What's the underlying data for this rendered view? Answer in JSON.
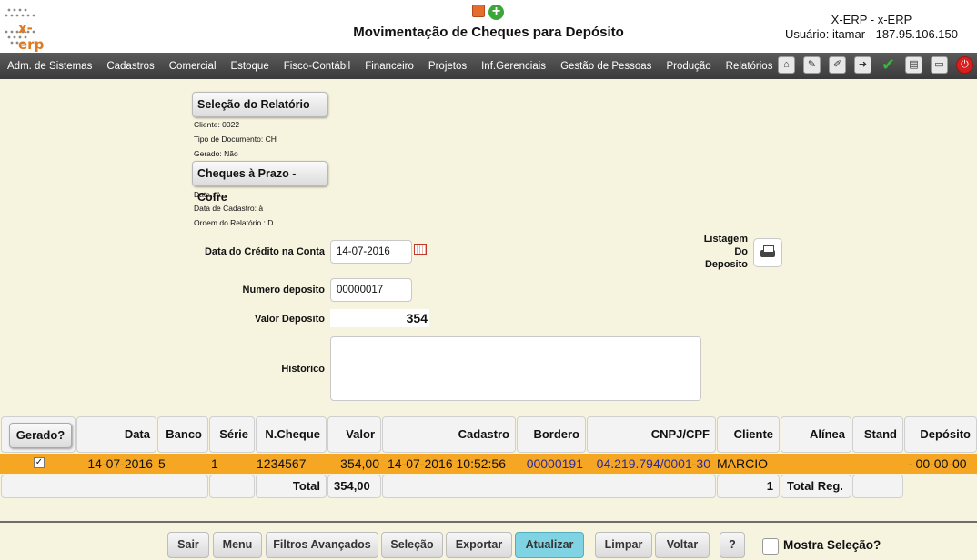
{
  "header": {
    "logo_text": "x-erp",
    "title": "Movimentação de Cheques para Depósito",
    "user_line1": "X-ERP - x-ERP",
    "user_line2": "Usuário: itamar - 187.95.106.150"
  },
  "menu": {
    "items": [
      "Adm. de Sistemas",
      "Cadastros",
      "Comercial",
      "Estoque",
      "Fisco-Contábil",
      "Financeiro",
      "Projetos",
      "Inf.Gerenciais",
      "Gestão de Pessoas",
      "Produção",
      "Relatórios"
    ],
    "icons": [
      "home-icon",
      "edit-icon",
      "edit-doc-icon",
      "export-icon",
      "check-icon",
      "document-icon",
      "print-icon",
      "power-icon"
    ]
  },
  "selecao": {
    "button": "Seleção do Relatório",
    "cliente": "Cliente: 0022",
    "tipo": "Tipo de Documento: CH",
    "gerado": "Gerado: Não"
  },
  "cheques": {
    "button": "Cheques à Prazo - Cofre",
    "data": "Data :  à",
    "data_cadastro": "Data de Cadastro:  à",
    "ordem": "Ordem do Relatório : D"
  },
  "form": {
    "data_credito_label": "Data do Crédito na Conta",
    "data_credito_value": "14-07-2016",
    "numero_label": "Numero deposito",
    "numero_value": "00000017",
    "valor_label": "Valor Deposito",
    "valor_value": "354",
    "historico_label": "Historico",
    "listagem_line1": "Listagem",
    "listagem_line2": "Do",
    "listagem_line3": "Deposito"
  },
  "table": {
    "headers": {
      "gerado": "Gerado?",
      "data": "Data",
      "banco": "Banco",
      "serie": "Série",
      "ncheque": "N.Cheque",
      "valor": "Valor",
      "cadastro": "Cadastro",
      "bordero": "Bordero",
      "cnpj": "CNPJ/CPF",
      "cliente": "Cliente",
      "alinea": "Alínea",
      "stand": "Stand",
      "deposito": "Depósito"
    },
    "row": {
      "checked": "✓",
      "data": "14-07-2016",
      "banco": "5",
      "serie": "1",
      "ncheque": "1234567",
      "valor": "354,00",
      "cadastro": "14-07-2016 10:52:56",
      "bordero": "00000191",
      "cnpj": "04.219.794/0001-30",
      "cliente": "MARCIO",
      "alinea": "",
      "stand": "",
      "deposito": "- 00-00-00"
    },
    "totals": {
      "label": "Total",
      "valor": "354,00",
      "count": "1",
      "reg_label": "Total Reg."
    }
  },
  "buttons": {
    "sair": "Sair",
    "menu": "Menu",
    "filtros": "Filtros Avançados",
    "selecao": "Seleção",
    "exportar": "Exportar",
    "atualizar": "Atualizar",
    "limpar": "Limpar",
    "voltar": "Voltar",
    "help": "?",
    "mostra": "Mostra Seleção?"
  }
}
